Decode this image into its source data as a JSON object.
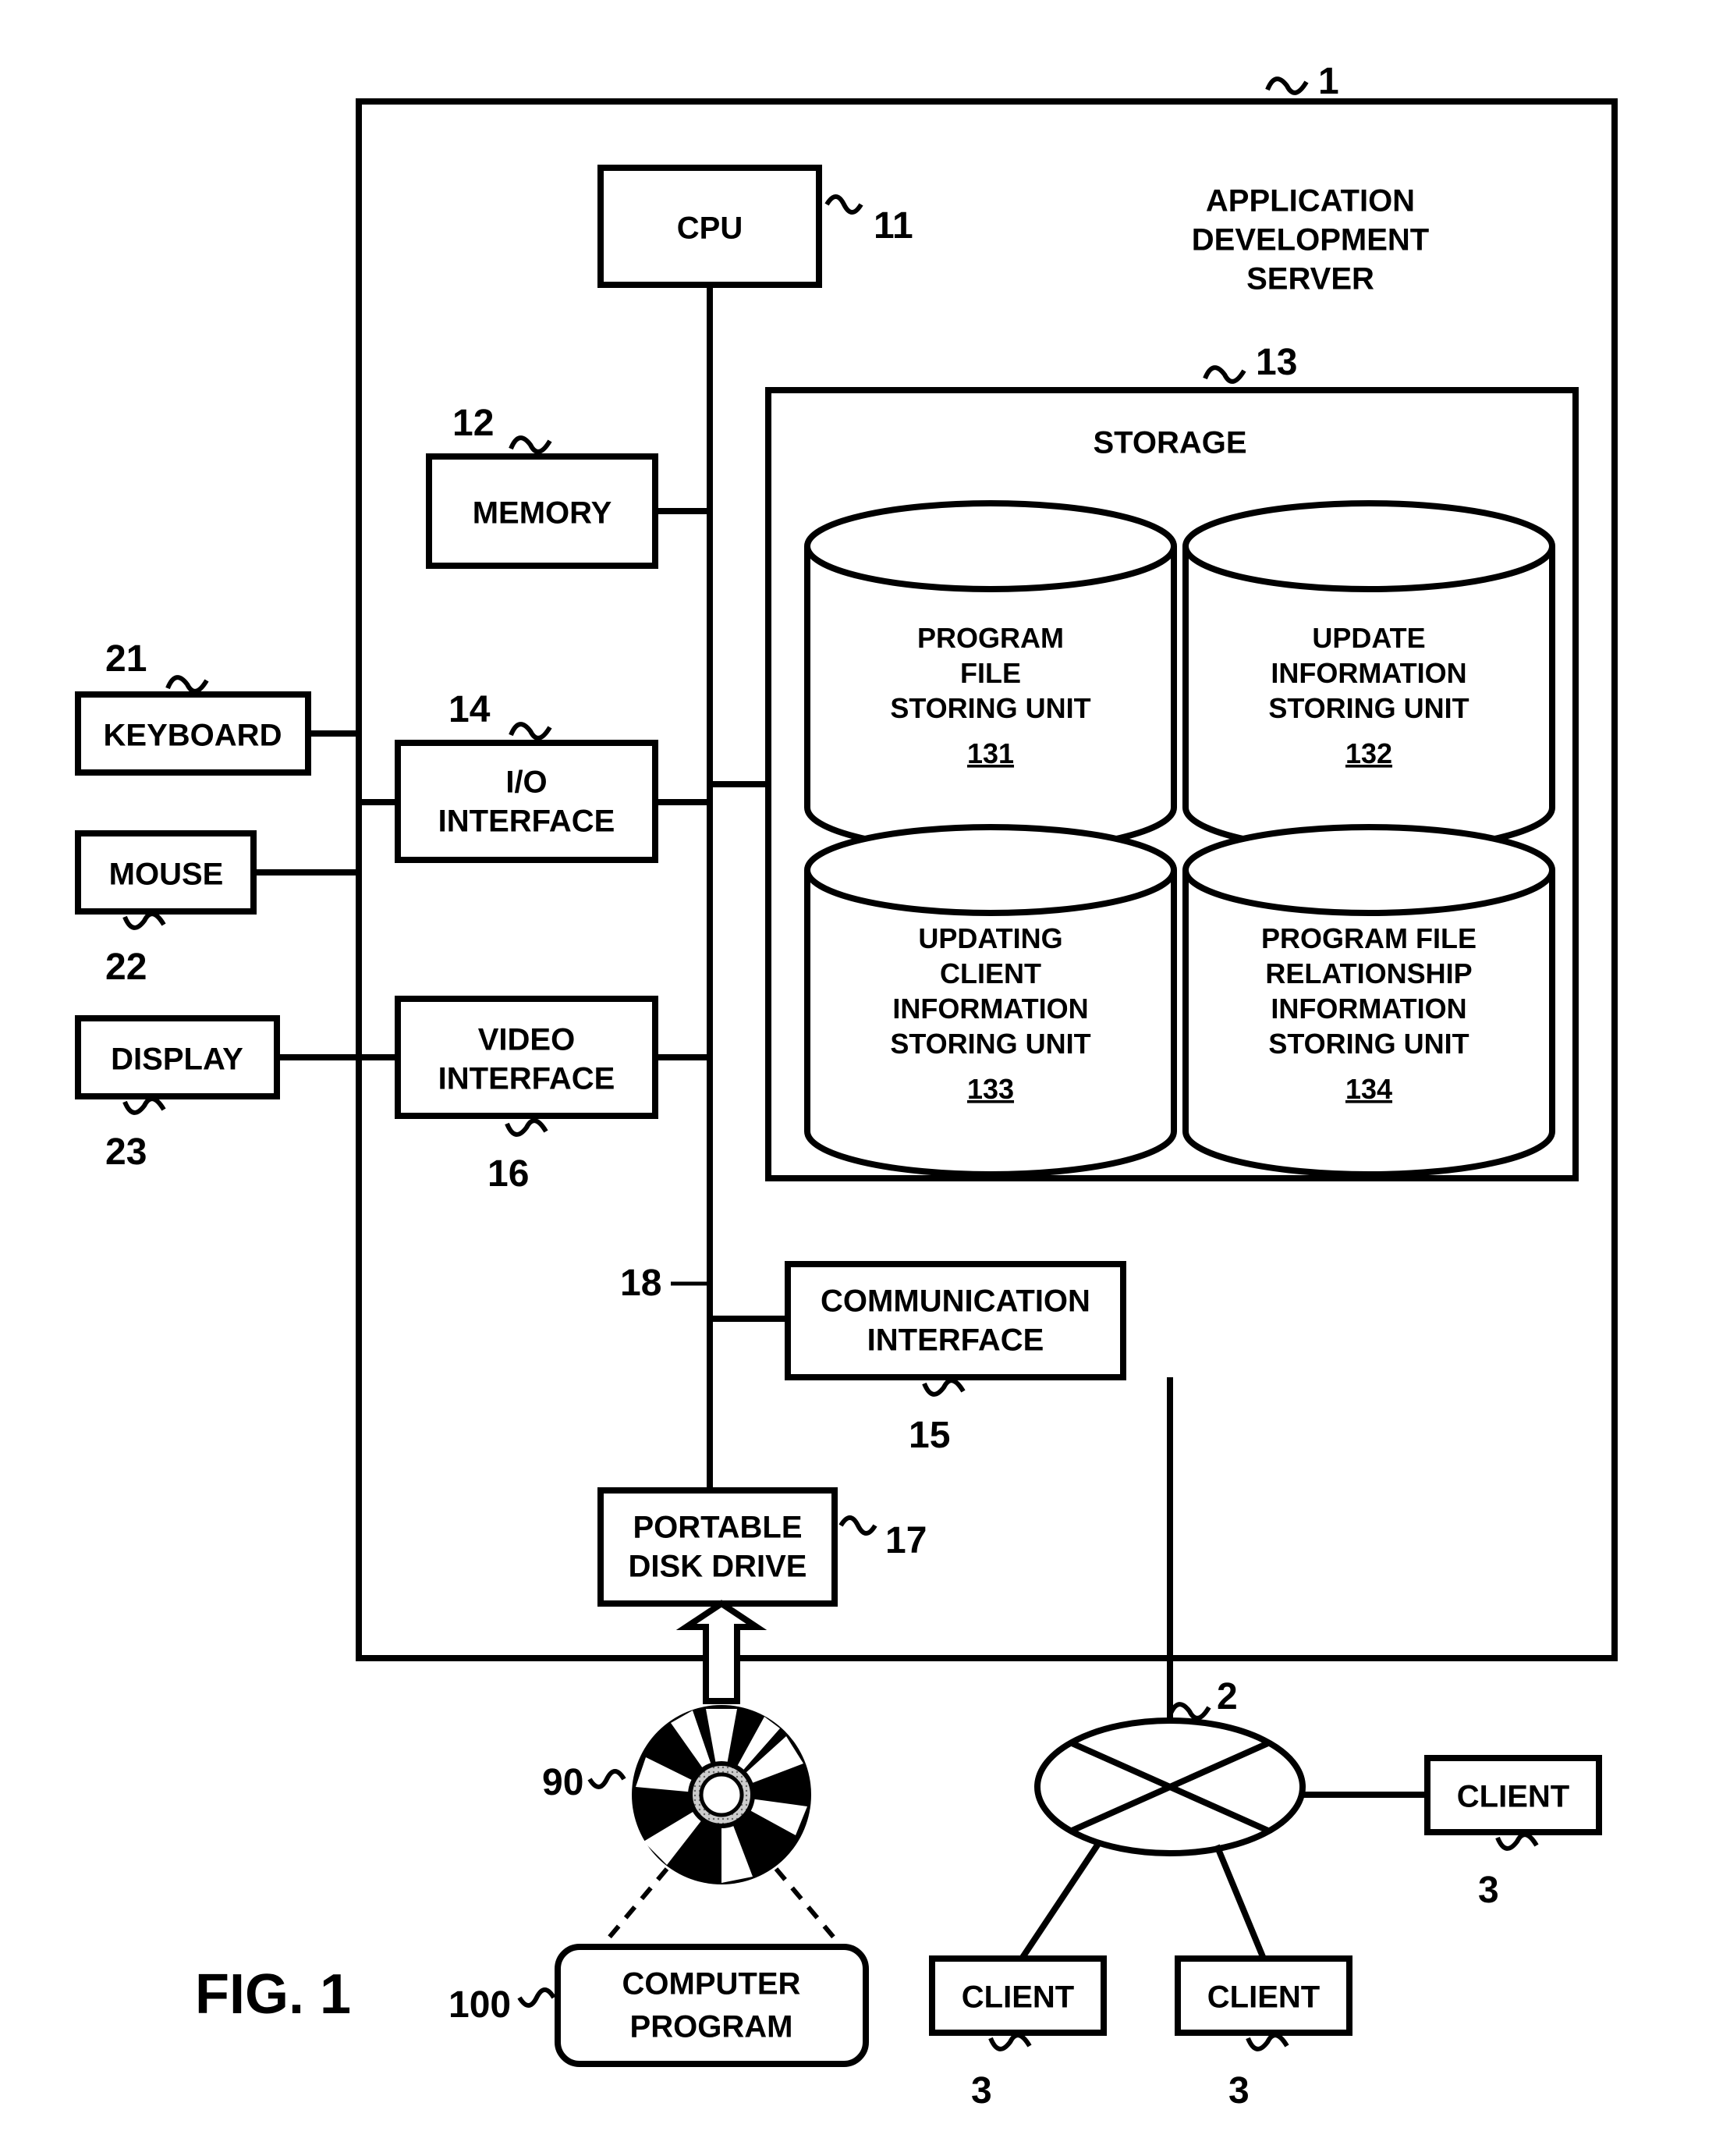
{
  "figure_label": "FIG. 1",
  "server": {
    "label_line1": "APPLICATION",
    "label_line2": "DEVELOPMENT",
    "label_line3": "SERVER",
    "ref": "1"
  },
  "cpu": {
    "label": "CPU",
    "ref": "11"
  },
  "memory": {
    "label": "MEMORY",
    "ref": "12"
  },
  "storage": {
    "label": "STORAGE",
    "ref": "13",
    "db131": {
      "l1": "PROGRAM",
      "l2": "FILE",
      "l3": "STORING UNIT",
      "num": "131"
    },
    "db132": {
      "l1": "UPDATE",
      "l2": "INFORMATION",
      "l3": "STORING UNIT",
      "num": "132"
    },
    "db133": {
      "l1": "UPDATING",
      "l2": "CLIENT",
      "l3": "INFORMATION",
      "l4": "STORING UNIT",
      "num": "133"
    },
    "db134": {
      "l1": "PROGRAM FILE",
      "l2": "RELATIONSHIP",
      "l3": "INFORMATION",
      "l4": "STORING UNIT",
      "num": "134"
    }
  },
  "io": {
    "label_l1": "I/O",
    "label_l2": "INTERFACE",
    "ref": "14"
  },
  "comm": {
    "label_l1": "COMMUNICATION",
    "label_l2": "INTERFACE",
    "ref": "15"
  },
  "video": {
    "label_l1": "VIDEO",
    "label_l2": "INTERFACE",
    "ref": "16"
  },
  "disk": {
    "label_l1": "PORTABLE",
    "label_l2": "DISK DRIVE",
    "ref": "17"
  },
  "bus": {
    "ref": "18"
  },
  "keyboard": {
    "label": "KEYBOARD",
    "ref": "21"
  },
  "mouse": {
    "label": "MOUSE",
    "ref": "22"
  },
  "display": {
    "label": "DISPLAY",
    "ref": "23"
  },
  "cd": {
    "ref": "90"
  },
  "program": {
    "label_l1": "COMPUTER",
    "label_l2": "PROGRAM",
    "ref": "100"
  },
  "network": {
    "ref": "2"
  },
  "client": {
    "label": "CLIENT",
    "ref": "3"
  }
}
